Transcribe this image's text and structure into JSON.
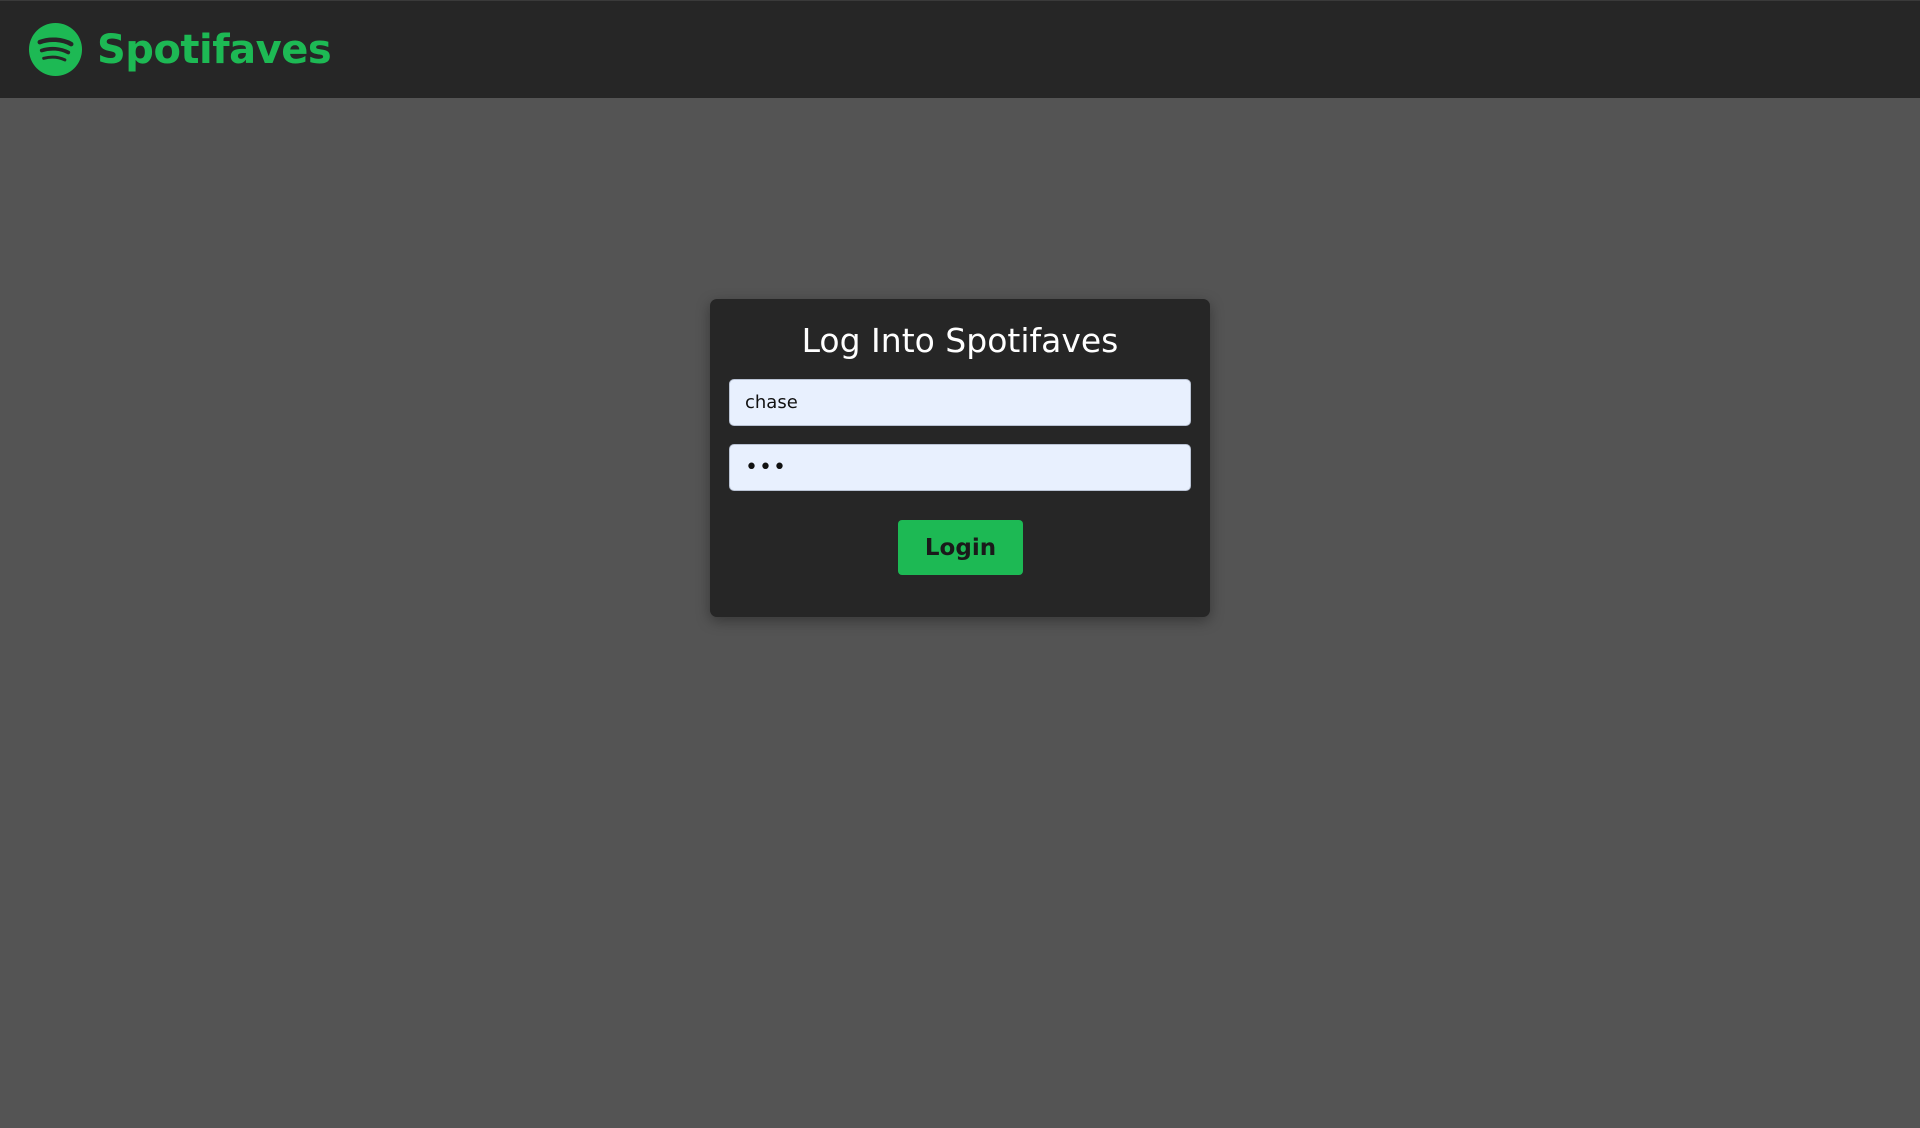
{
  "header": {
    "brand_name": "Spotifaves",
    "logo_icon": "spotify-logo-icon",
    "brand_color": "#1db954"
  },
  "login_form": {
    "title": "Log Into Spotifaves",
    "username_value": "chase",
    "password_value": "abc",
    "login_label": "Login"
  },
  "colors": {
    "page_background": "#545454",
    "header_background": "#262626",
    "card_background": "#262626",
    "accent": "#1db954",
    "input_background": "#e8f0fe"
  }
}
